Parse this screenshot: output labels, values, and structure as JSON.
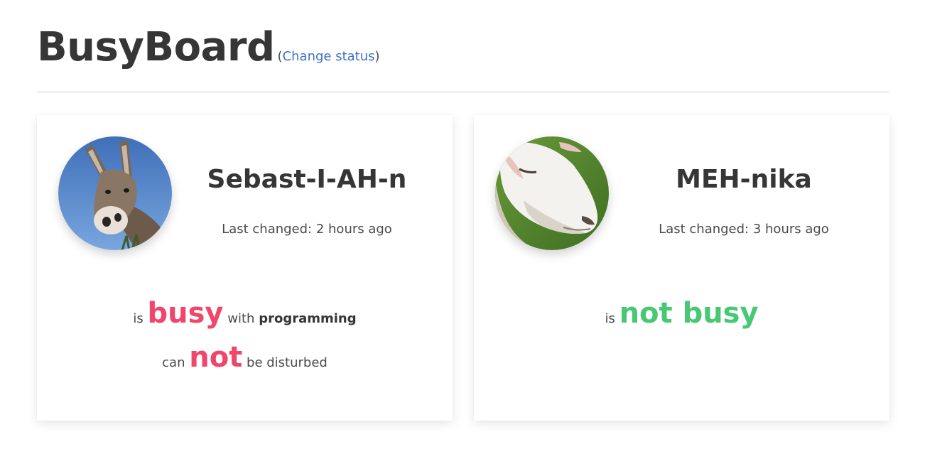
{
  "header": {
    "title": "BusyBoard",
    "open_paren": "(",
    "change_status_link": "Change status",
    "close_paren": ")"
  },
  "people": [
    {
      "name": "Sebast-I-AH-n",
      "last_changed": "Last changed: 2 hours ago",
      "avatar_icon": "donkey-avatar",
      "status": {
        "prefix": "is",
        "state": "busy",
        "with_text": "with",
        "activity": "programming",
        "can_text": "can",
        "not_text": "not",
        "disturb_text": "be disturbed"
      }
    },
    {
      "name": "MEH-nika",
      "last_changed": "Last changed: 3 hours ago",
      "avatar_icon": "sheep-avatar",
      "status": {
        "prefix": "is",
        "state": "not busy"
      }
    }
  ],
  "colors": {
    "busy": "#f0466b",
    "not_busy": "#48c774",
    "link": "#3e6fcf",
    "title": "#363636"
  }
}
